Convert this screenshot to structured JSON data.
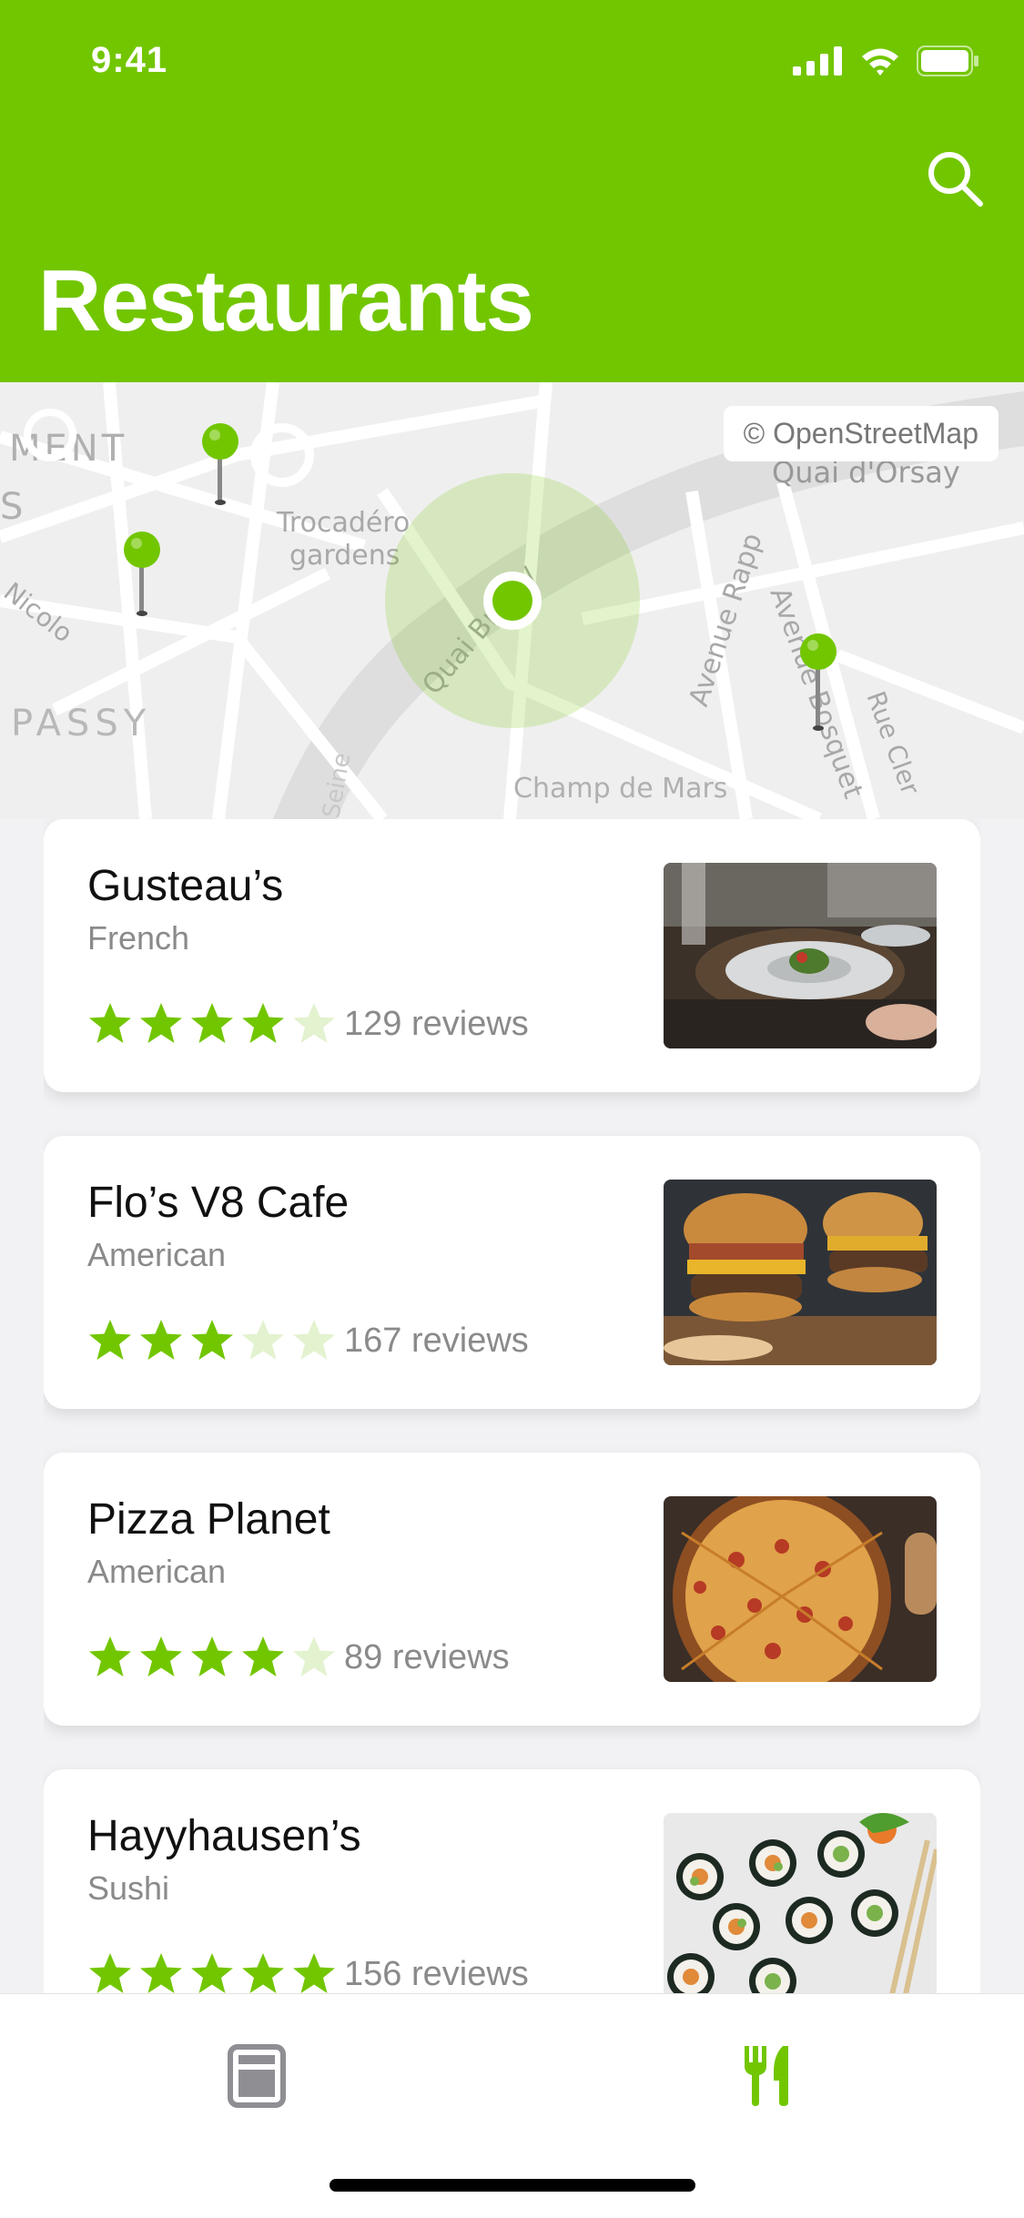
{
  "status_bar": {
    "time": "9:41"
  },
  "header": {
    "title": "Restaurants",
    "search_icon": "search-icon"
  },
  "map": {
    "attribution": "© OpenStreetMap",
    "labels": [
      "MENT",
      "S",
      "Trocadéro",
      "gardens",
      "Nicolo",
      "PASSY",
      "Quai Branly",
      "Avenue Rapp",
      "Avenue Bosquet",
      "Rue Cler",
      "Quai d'Orsay",
      "Champ de Mars",
      "Seine"
    ],
    "accent_color": "#72c600"
  },
  "restaurants": [
    {
      "name": "Gusteau’s",
      "cuisine": "French",
      "rating": 4,
      "reviews": "129 reviews"
    },
    {
      "name": "Flo’s V8 Cafe",
      "cuisine": "American",
      "rating": 3,
      "reviews": "167 reviews"
    },
    {
      "name": "Pizza Planet",
      "cuisine": "American",
      "rating": 4,
      "reviews": "89 reviews"
    },
    {
      "name": "Hayyhausen’s",
      "cuisine": "Sushi",
      "rating": 5,
      "reviews": "156 reviews"
    }
  ],
  "tabbar": {
    "items": [
      "news-icon",
      "fork-knife-icon"
    ],
    "active": 1
  }
}
